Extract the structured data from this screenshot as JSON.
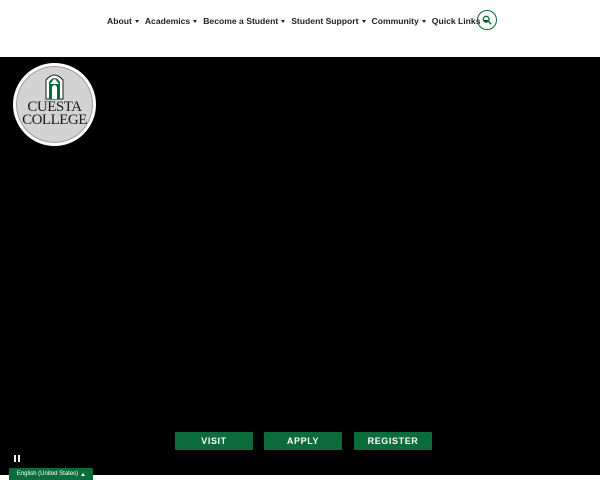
{
  "nav": {
    "items": [
      {
        "label": "About"
      },
      {
        "label": "Academics"
      },
      {
        "label": "Become a Student"
      },
      {
        "label": "Student Support"
      },
      {
        "label": "Community"
      },
      {
        "label": "Quick Links"
      }
    ],
    "search_icon": "search-icon"
  },
  "logo": {
    "line1": "CUESTA",
    "line2": "COLLEGE"
  },
  "cta": {
    "visit": "VISIT",
    "apply": "APPLY",
    "register": "REGISTER"
  },
  "video_controls": {
    "pause_icon": "pause-icon"
  },
  "language": {
    "label": "English (United States)"
  },
  "colors": {
    "brand_green": "#0b6b3a",
    "hero_bg": "#000000",
    "nav_text": "#1f1f1f"
  }
}
